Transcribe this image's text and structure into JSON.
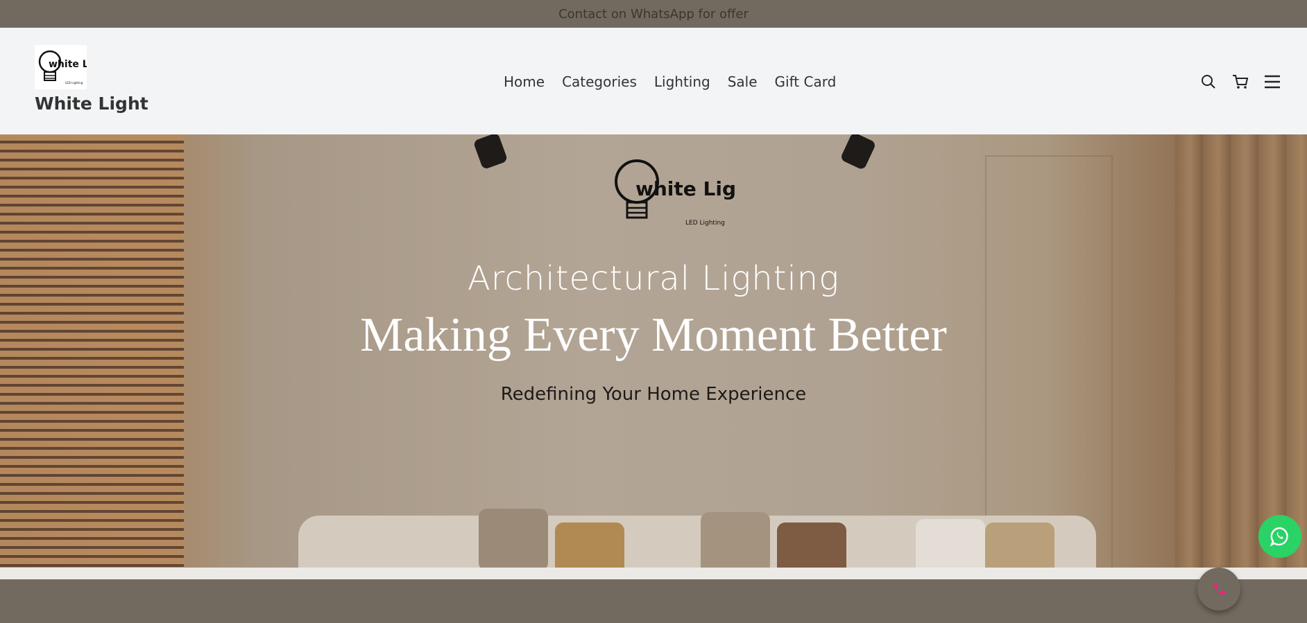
{
  "announcement": {
    "text": "Contact on WhatsApp for offer"
  },
  "header": {
    "brand": "White Light",
    "logo_text": "white Light",
    "logo_sub": "LED Lighting",
    "nav": [
      "Home",
      "Categories",
      "Lighting",
      "Sale",
      "Gift Card"
    ],
    "icons": [
      "search-icon",
      "cart-icon",
      "menu-icon"
    ]
  },
  "hero": {
    "logo_text": "white Light",
    "logo_sub": "LED Lighting",
    "subtitle": "Architectural Lighting",
    "title": "Making Every Moment Better",
    "tagline": "Redefining Your Home Experience"
  },
  "floating": {
    "whatsapp_icon": "whatsapp-icon",
    "call_icon": "phone-icon",
    "whatsapp_color": "#2bd266",
    "call_icon_color": "#e8257a"
  },
  "colors": {
    "announce_bg": "#726a5f",
    "header_bg": "#f3f4f6"
  }
}
